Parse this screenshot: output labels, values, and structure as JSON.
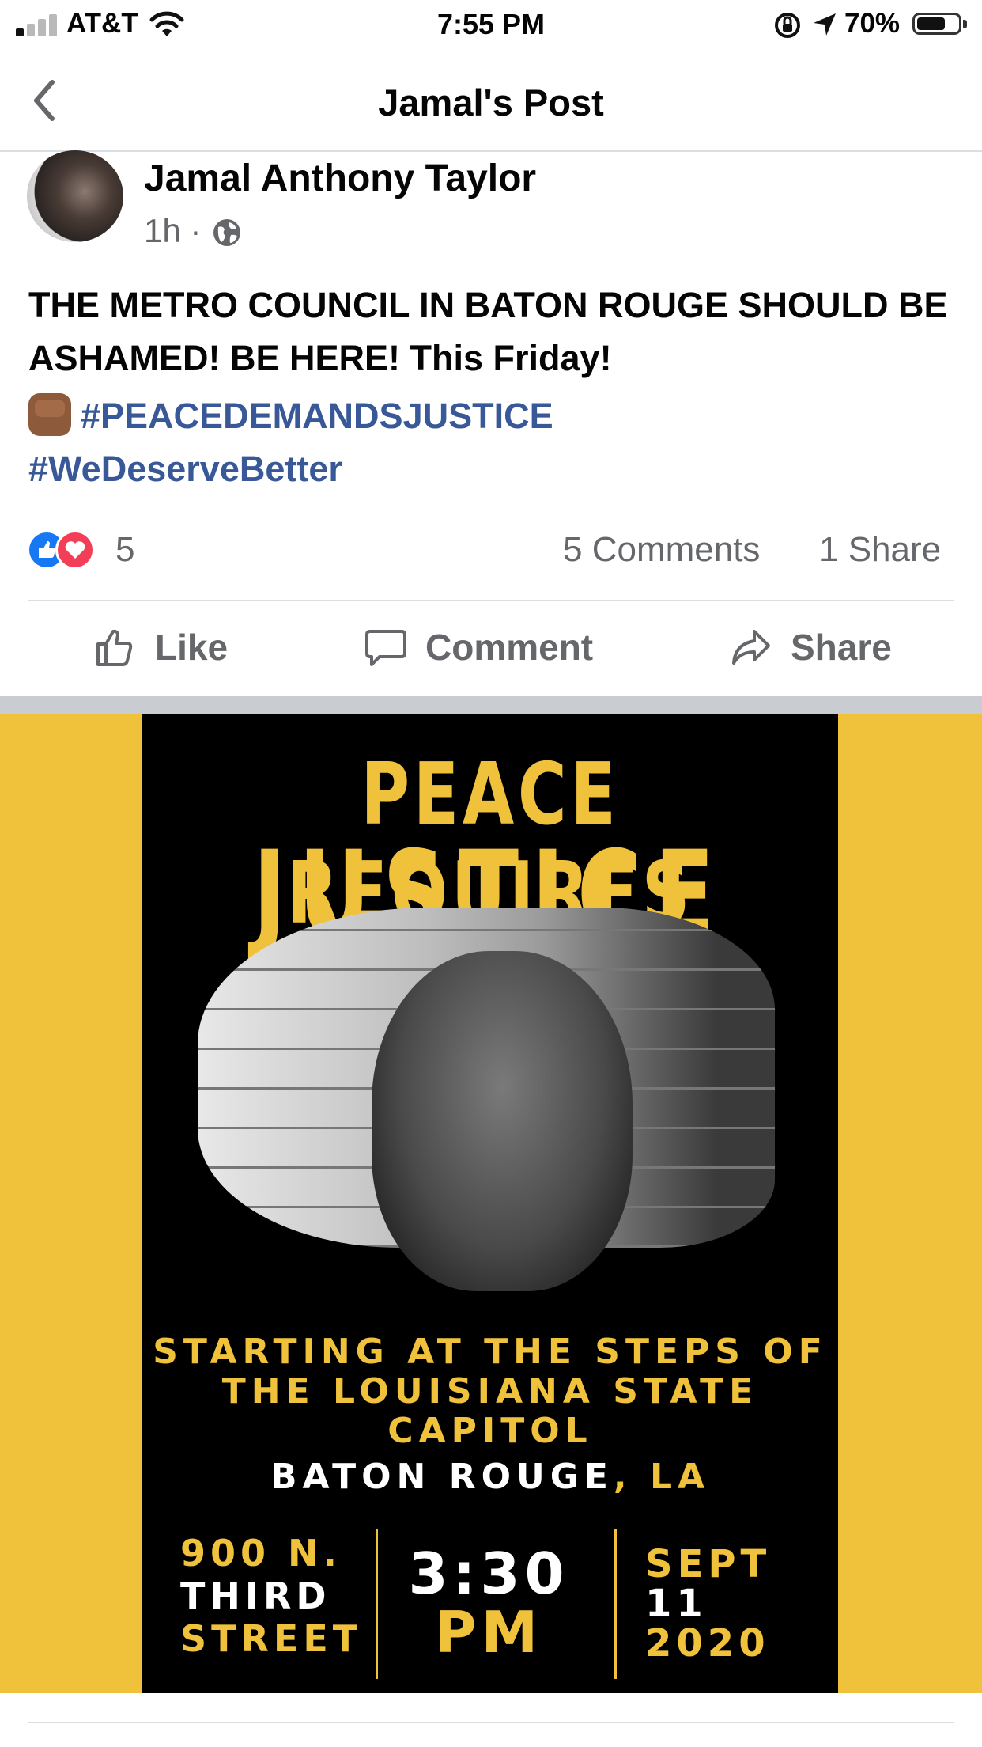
{
  "status_bar": {
    "carrier": "AT&T",
    "time": "7:55 PM",
    "battery": "70%",
    "battery_level": 0.7
  },
  "nav": {
    "title": "Jamal's Post"
  },
  "post": {
    "author": "Jamal Anthony Taylor",
    "time_ago": "1h",
    "meta_separator": "·",
    "text": "THE METRO COUNCIL IN BATON ROUGE SHOULD BE ASHAMED! BE HERE! This Friday!",
    "hashtag1": "#PEACEDEMANDSJUSTICE",
    "hashtag2": "#WeDeserveBetter",
    "reaction_count": "5",
    "comments": "5 Comments",
    "shares": "1 Share",
    "actions": {
      "like": "Like",
      "comment": "Comment",
      "share": "Share"
    }
  },
  "poster": {
    "title_line1": "PEACE REQUIRES",
    "title_line2": "JUSTICE",
    "location_line1": "STARTING AT THE STEPS OF",
    "location_line2": "THE LOUISIANA STATE",
    "location_line3": "CAPITOL",
    "city": "BATON ROUGE",
    "city_sep": ",",
    "state": "LA",
    "address_line1": "900 N.",
    "address_line2": "THIRD",
    "address_line3": "STREET",
    "time_line1": "3:30",
    "time_line2": "PM",
    "date_line1": "SEPT",
    "date_line2": "11",
    "date_line3": "2020"
  },
  "colors": {
    "poster_yellow": "#f0c23b",
    "link_blue": "#385898",
    "muted_gray": "#65676b",
    "like_blue": "#1877f2",
    "love_red": "#f33e58"
  }
}
